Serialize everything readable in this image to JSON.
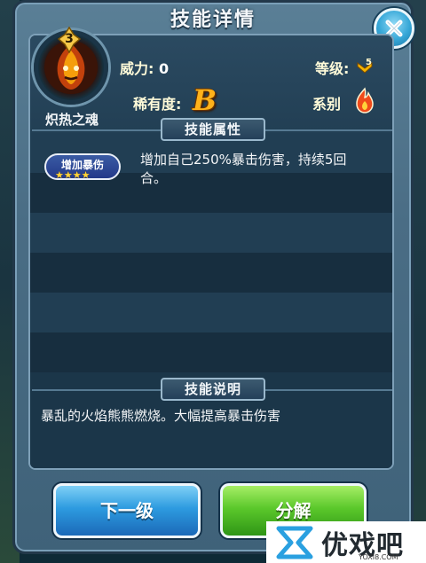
{
  "dialog": {
    "title": "技能详情",
    "close_icon": "close-x-icon"
  },
  "skill": {
    "name": "炽热之魂",
    "level": "3",
    "icon": "fire-demon-portrait"
  },
  "stats": {
    "power_label": "威力:",
    "power_value": "0",
    "grade_label": "等级:",
    "grade_icon": "level-5-chevron-icon",
    "rarity_label": "稀有度:",
    "rarity_value": "B",
    "element_label": "系别",
    "element_icon": "fire-element-icon"
  },
  "attributes": {
    "section_title": "技能属性",
    "tag_label": "增加暴伤",
    "tag_stars": 4,
    "effect": "增加自己250%暴击伤害，持续5回合。"
  },
  "description": {
    "section_title": "技能说明",
    "text": "暴乱的火焰熊熊燃烧。大幅提高暴击伤害"
  },
  "actions": {
    "next_level_label": "下一级",
    "decompose_label": "分解"
  },
  "watermark": {
    "text": "优戏吧",
    "sub": "YOXI8.COM"
  },
  "colors": {
    "rarity_b": "#ffb21a",
    "next_button": "#2d9be0",
    "decompose_button": "#5bc82b",
    "close_button": "#36a7d7"
  }
}
